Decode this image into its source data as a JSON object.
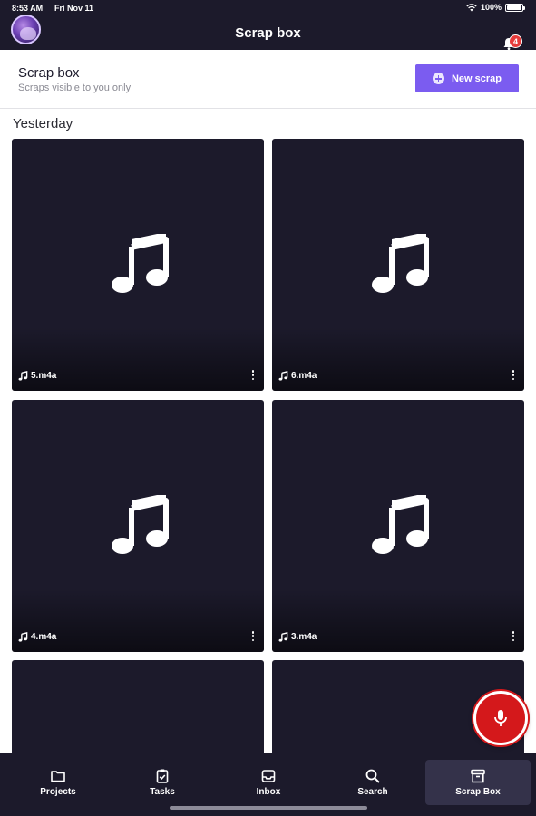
{
  "status_bar": {
    "time": "8:53 AM",
    "date": "Fri Nov 11",
    "battery": "100%"
  },
  "header": {
    "title": "Scrap box",
    "notification_count": "4"
  },
  "section": {
    "title": "Scrap box",
    "subtitle": "Scraps visible to you only",
    "new_button_label": "New scrap"
  },
  "group_label": "Yesterday",
  "scraps": [
    {
      "name": "5.m4a",
      "icon": "music-note-icon"
    },
    {
      "name": "6.m4a",
      "icon": "music-note-icon"
    },
    {
      "name": "4.m4a",
      "icon": "music-note-icon"
    },
    {
      "name": "3.m4a",
      "icon": "music-note-icon"
    },
    {
      "name": "",
      "icon": ""
    },
    {
      "name": "",
      "icon": ""
    }
  ],
  "nav": {
    "items": [
      {
        "label": "Projects",
        "icon": "folder-icon"
      },
      {
        "label": "Tasks",
        "icon": "clipboard-check-icon"
      },
      {
        "label": "Inbox",
        "icon": "inbox-icon"
      },
      {
        "label": "Search",
        "icon": "search-icon"
      },
      {
        "label": "Scrap Box",
        "icon": "archive-box-icon"
      }
    ],
    "active": "Scrap Box"
  },
  "colors": {
    "dark": "#1c1a2b",
    "accent": "#7b5cf0",
    "record": "#d4181b",
    "badge": "#e63b3b"
  }
}
